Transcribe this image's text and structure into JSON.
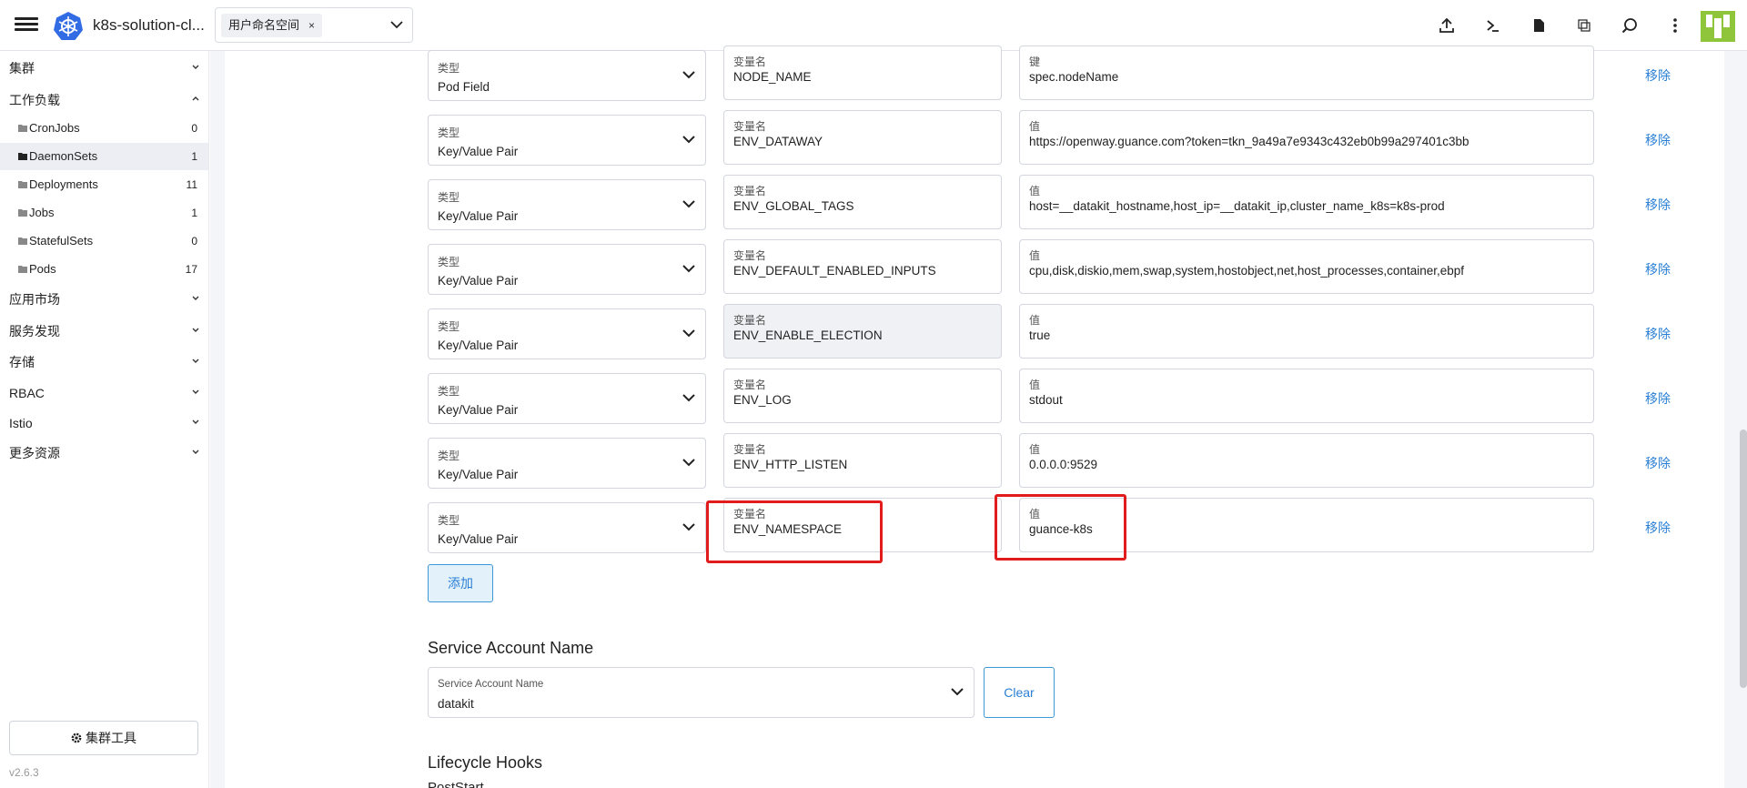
{
  "header": {
    "cluster_name": "k8s-solution-cl...",
    "namespace_chip": "用户命名空间",
    "namespace_chip_remove": "×"
  },
  "toolbar_icons": [
    "import-yaml-icon",
    "kubectl-shell-icon",
    "kubeconfig-file-icon",
    "copy-kubeconfig-icon",
    "search-icon",
    "more-options-icon"
  ],
  "sidebar": {
    "groups": [
      {
        "label": "集群",
        "expanded": false
      },
      {
        "label": "工作负载",
        "expanded": true
      },
      {
        "label": "应用市场",
        "expanded": false
      },
      {
        "label": "服务发现",
        "expanded": false
      },
      {
        "label": "存储",
        "expanded": false
      },
      {
        "label": "RBAC",
        "expanded": false
      },
      {
        "label": "Istio",
        "expanded": false
      },
      {
        "label": "更多资源",
        "expanded": false
      }
    ],
    "workload_items": [
      {
        "label": "CronJobs",
        "count": "0"
      },
      {
        "label": "DaemonSets",
        "count": "1",
        "active": true
      },
      {
        "label": "Deployments",
        "count": "11"
      },
      {
        "label": "Jobs",
        "count": "1"
      },
      {
        "label": "StatefulSets",
        "count": "0"
      },
      {
        "label": "Pods",
        "count": "17"
      }
    ],
    "tools_button": "集群工具",
    "version": "v2.6.3"
  },
  "env_vars": [
    {
      "type_label": "类型",
      "type": "Pod Field",
      "name_label": "变量名",
      "name": "NODE_NAME",
      "value_label": "键",
      "value": "spec.nodeName",
      "remove": "移除"
    },
    {
      "type_label": "类型",
      "type": "Key/Value Pair",
      "name_label": "变量名",
      "name": "ENV_DATAWAY",
      "value_label": "值",
      "value": "https://openway.guance.com?token=tkn_9a49a7e9343c432eb0b99a297401c3bb",
      "remove": "移除"
    },
    {
      "type_label": "类型",
      "type": "Key/Value Pair",
      "name_label": "变量名",
      "name": "ENV_GLOBAL_TAGS",
      "value_label": "值",
      "value": "host=__datakit_hostname,host_ip=__datakit_ip,cluster_name_k8s=k8s-prod",
      "remove": "移除"
    },
    {
      "type_label": "类型",
      "type": "Key/Value Pair",
      "name_label": "变量名",
      "name": "ENV_DEFAULT_ENABLED_INPUTS",
      "value_label": "值",
      "value": "cpu,disk,diskio,mem,swap,system,hostobject,net,host_processes,container,ebpf",
      "remove": "移除"
    },
    {
      "type_label": "类型",
      "type": "Key/Value Pair",
      "name_label": "变量名",
      "name": "ENV_ENABLE_ELECTION",
      "value_label": "值",
      "value": "true",
      "remove": "移除",
      "name_disabled": true
    },
    {
      "type_label": "类型",
      "type": "Key/Value Pair",
      "name_label": "变量名",
      "name": "ENV_LOG",
      "value_label": "值",
      "value": "stdout",
      "remove": "移除"
    },
    {
      "type_label": "类型",
      "type": "Key/Value Pair",
      "name_label": "变量名",
      "name": "ENV_HTTP_LISTEN",
      "value_label": "值",
      "value": "0.0.0.0:9529",
      "remove": "移除"
    },
    {
      "type_label": "类型",
      "type": "Key/Value Pair",
      "name_label": "变量名",
      "name": "ENV_NAMESPACE",
      "value_label": "值",
      "value": "guance-k8s",
      "remove": "移除"
    }
  ],
  "add_button": "添加",
  "service_account": {
    "section_title": "Service Account Name",
    "field_label": "Service Account Name",
    "value": "datakit",
    "clear_button": "Clear"
  },
  "lifecycle": {
    "section_title": "Lifecycle Hooks",
    "post_start": "PostStart"
  },
  "colors": {
    "accent": "#2a7fd4",
    "highlight": "#e01c1c",
    "active_nav": "#eceef3"
  }
}
